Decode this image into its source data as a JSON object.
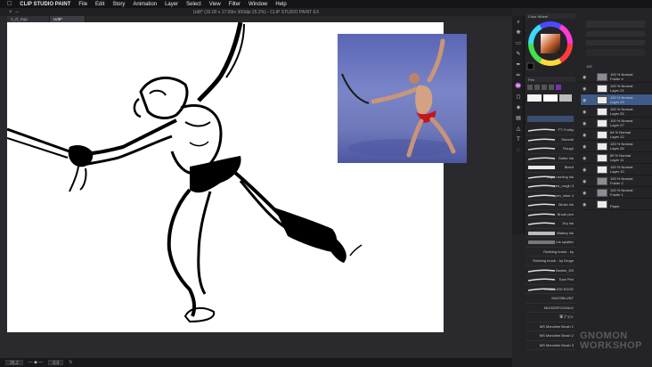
{
  "menubar": {
    "app_name": "CLIP STUDIO PAINT",
    "items": [
      "File",
      "Edit",
      "Story",
      "Animation",
      "Layer",
      "Select",
      "View",
      "Filter",
      "Window",
      "Help"
    ]
  },
  "window": {
    "title": "Ud8* (32.00 x 17.00in 300dpi 25.2%) - CLIP STUDIO PAINT EX"
  },
  "tabs": [
    {
      "label": "1_cl_Sup"
    },
    {
      "label": "Ud8*"
    }
  ],
  "statusbar": {
    "zoom": "25.2",
    "angle": "0.0"
  },
  "panels": {
    "color_wheel_title": "Color Wheel",
    "subtool_title": "Pen",
    "brushes_selected": "Ink Brush",
    "brushes": [
      "FT: Funky",
      "Smooth",
      "Rough",
      "Softer ink",
      "Bleed",
      "Light running ink",
      "pen_rough 3",
      "pen_inker 4",
      "Brush ink",
      "Brush pen",
      "Dry ink",
      "Watery ink",
      "Ink splatter",
      "Rubbing brush - by",
      "Rubbing brush - by Droge",
      "Nankin_DS",
      "Toce Pen",
      "INKBRUSH EDGE",
      "MUO2BLUNT",
      "MUO2DRYCHALK",
      "筆ブラシ",
      "MS Monoline Brush 1",
      "MS Monoline Brush 2",
      "MS Monoline Brush 3"
    ],
    "layers": [
      {
        "opacity": "100 % Normal",
        "name": "Folder 4",
        "folder": true
      },
      {
        "opacity": "100 % Normal",
        "name": "Layer 24",
        "folder": false
      },
      {
        "opacity": "100 % Normal",
        "name": "Layer 29",
        "folder": false,
        "selected": true
      },
      {
        "opacity": "100 % Normal",
        "name": "Layer 25",
        "folder": false
      },
      {
        "opacity": "100 % Normal",
        "name": "Layer 27",
        "folder": false
      },
      {
        "opacity": "64 % Normal",
        "name": "Layer 12",
        "folder": false
      },
      {
        "opacity": "100 % Normal",
        "name": "Layer 26",
        "folder": false
      },
      {
        "opacity": "89 % Normal",
        "name": "Layer 11",
        "folder": false
      },
      {
        "opacity": "100 % Normal",
        "name": "Layer 10",
        "folder": false
      },
      {
        "opacity": "100 % Normal",
        "name": "Folder 2",
        "folder": true
      },
      {
        "opacity": "100 % Normal",
        "name": "Folder 1",
        "folder": true
      },
      {
        "opacity": "",
        "name": "Paper",
        "folder": false
      }
    ],
    "layer_opacity_value": "100"
  },
  "watermark": {
    "line1": "GNOMON",
    "line2": "WORKSHOP"
  },
  "colors": {
    "accent": "#3e5b8a",
    "paper": "#ffffff",
    "reference_bg": "#6d77b9"
  }
}
